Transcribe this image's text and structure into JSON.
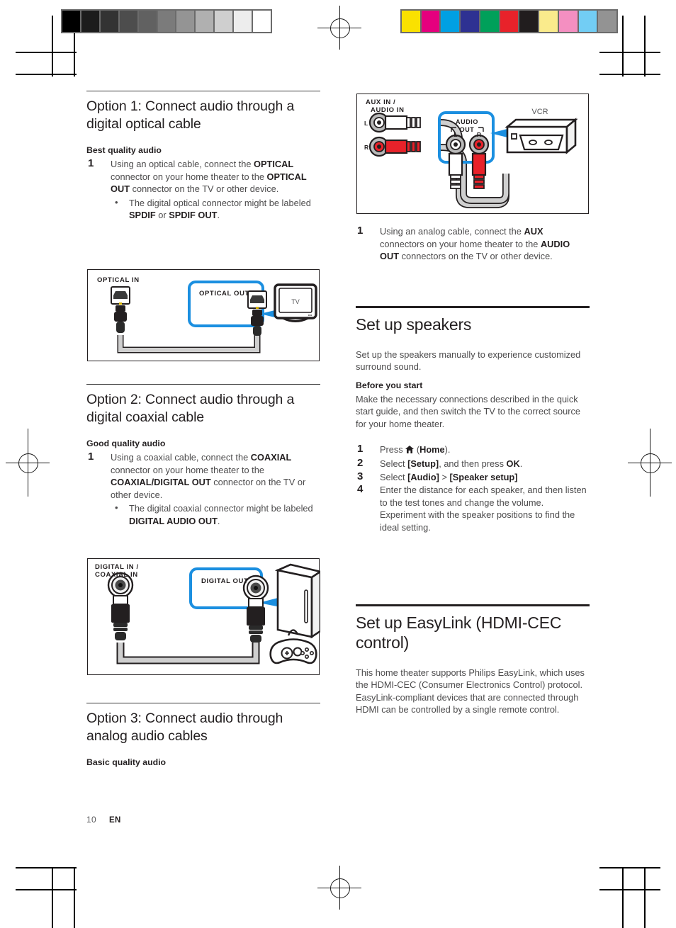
{
  "page": {
    "number": "10",
    "language": "EN"
  },
  "print_marks": {
    "grayscale_label": "grayscale-step-wedge",
    "grayscale_swatches": [
      "#000000",
      "#1c1c1c",
      "#333333",
      "#4d4d4d",
      "#616161",
      "#7b7b7b",
      "#949494",
      "#b0b0b0",
      "#cfcfcf",
      "#ededed",
      "#ffffff"
    ],
    "color_label": "color-control-bar",
    "color_swatches": [
      "#fae100",
      "#e5007e",
      "#00a0e3",
      "#2e3192",
      "#00a05a",
      "#e8222a",
      "#211d1e",
      "#faeb8c",
      "#f48fc1",
      "#72cdf4",
      "#939393"
    ],
    "registration_label": "registration-target"
  },
  "left_column": {
    "option1": {
      "heading": "Option 1: Connect audio through a digital optical cable",
      "quality": "Best quality audio",
      "step_number": "1",
      "step_text_parts": [
        {
          "t": "Using an optical cable, connect the ",
          "b": false
        },
        {
          "t": "OPTICAL",
          "b": true
        },
        {
          "t": " connector on your home theater to the ",
          "b": false
        },
        {
          "t": "OPTICAL OUT",
          "b": true
        },
        {
          "t": " connector on the TV or other device.",
          "b": false
        }
      ],
      "bullet_parts": [
        {
          "t": "The digital optical connector might be labeled ",
          "b": false
        },
        {
          "t": "SPDIF",
          "b": true
        },
        {
          "t": " or ",
          "b": false
        },
        {
          "t": "SPDIF OUT",
          "b": true
        },
        {
          "t": ".",
          "b": false
        }
      ],
      "figure": {
        "name": "optical-connection-diagram",
        "in_label": "OPTICAL IN",
        "out_label": "OPTICAL OUT",
        "device_label": "TV",
        "callout_color": "#1b8fe0"
      }
    },
    "option2": {
      "heading": "Option 2: Connect audio through a digital coaxial cable",
      "quality": "Good quality audio",
      "step_number": "1",
      "step_text_parts": [
        {
          "t": "Using a coaxial cable, connect the ",
          "b": false
        },
        {
          "t": "COAXIAL",
          "b": true
        },
        {
          "t": " connector on your home theater to the ",
          "b": false
        },
        {
          "t": "COAXIAL/DIGITAL OUT",
          "b": true
        },
        {
          "t": " connector on the TV or other device.",
          "b": false
        }
      ],
      "bullet_parts": [
        {
          "t": "The digital coaxial connector might be labeled ",
          "b": false
        },
        {
          "t": "DIGITAL AUDIO OUT",
          "b": true
        },
        {
          "t": ".",
          "b": false
        }
      ],
      "figure": {
        "name": "coaxial-connection-diagram",
        "in_label_line1": "DIGITAL IN /",
        "in_label_line2": "COAXIAL IN",
        "out_label": "DIGITAL OUT",
        "callout_color": "#1b8fe0"
      }
    },
    "option3": {
      "heading": "Option 3: Connect audio through analog audio cables",
      "quality": "Basic quality audio"
    }
  },
  "right_column": {
    "aux_figure": {
      "name": "aux-connection-diagram",
      "in_label_line1": "AUX IN /",
      "in_label_line2": "AUDIO IN",
      "left_channel": "L",
      "right_channel": "R",
      "out_label_line1": "AUDIO",
      "out_label_line2": "OUT",
      "out_left": "L",
      "out_right": "R",
      "device_label": "VCR",
      "callout_color": "#1b8fe0",
      "red_color": "#e8222a"
    },
    "aux_step": {
      "step_number": "1",
      "parts": [
        {
          "t": "Using an analog cable, connect the ",
          "b": false
        },
        {
          "t": "AUX",
          "b": true
        },
        {
          "t": " connectors on your home theater to the ",
          "b": false
        },
        {
          "t": "AUDIO OUT",
          "b": true
        },
        {
          "t": " connectors on the TV or other device.",
          "b": false
        }
      ]
    },
    "speakers": {
      "heading": "Set up speakers",
      "intro": "Set up the speakers manually to experience customized surround sound.",
      "before_heading": "Before you start",
      "before_text": "Make the necessary connections described in the quick start guide, and then switch the TV to the correct source for your home theater.",
      "steps": [
        {
          "num": "1",
          "parts": [
            {
              "t": "Press ",
              "b": false
            },
            {
              "icon": "home-icon"
            },
            {
              "t": " (",
              "b": false
            },
            {
              "t": "Home",
              "b": true
            },
            {
              "t": ").",
              "b": false
            }
          ]
        },
        {
          "num": "2",
          "parts": [
            {
              "t": "Select ",
              "b": false
            },
            {
              "t": "[Setup]",
              "b": true
            },
            {
              "t": ", and then press ",
              "b": false
            },
            {
              "t": "OK",
              "b": true
            },
            {
              "t": ".",
              "b": false
            }
          ]
        },
        {
          "num": "3",
          "parts": [
            {
              "t": "Select ",
              "b": false
            },
            {
              "t": "[Audio]",
              "b": true
            },
            {
              "t": " > ",
              "b": false
            },
            {
              "t": "[Speaker setup]",
              "b": true
            }
          ]
        },
        {
          "num": "4",
          "parts": [
            {
              "t": "Enter the distance for each speaker, and then listen to the test tones and change the volume. Experiment with the speaker positions to find the ideal setting.",
              "b": false
            }
          ]
        }
      ]
    },
    "easylink": {
      "heading": "Set up EasyLink (HDMI-CEC control)",
      "body": "This home theater supports Philips EasyLink, which uses the HDMI-CEC (Consumer Electronics Control) protocol. EasyLink-compliant devices that are connected through HDMI can be controlled by a single remote control."
    }
  }
}
